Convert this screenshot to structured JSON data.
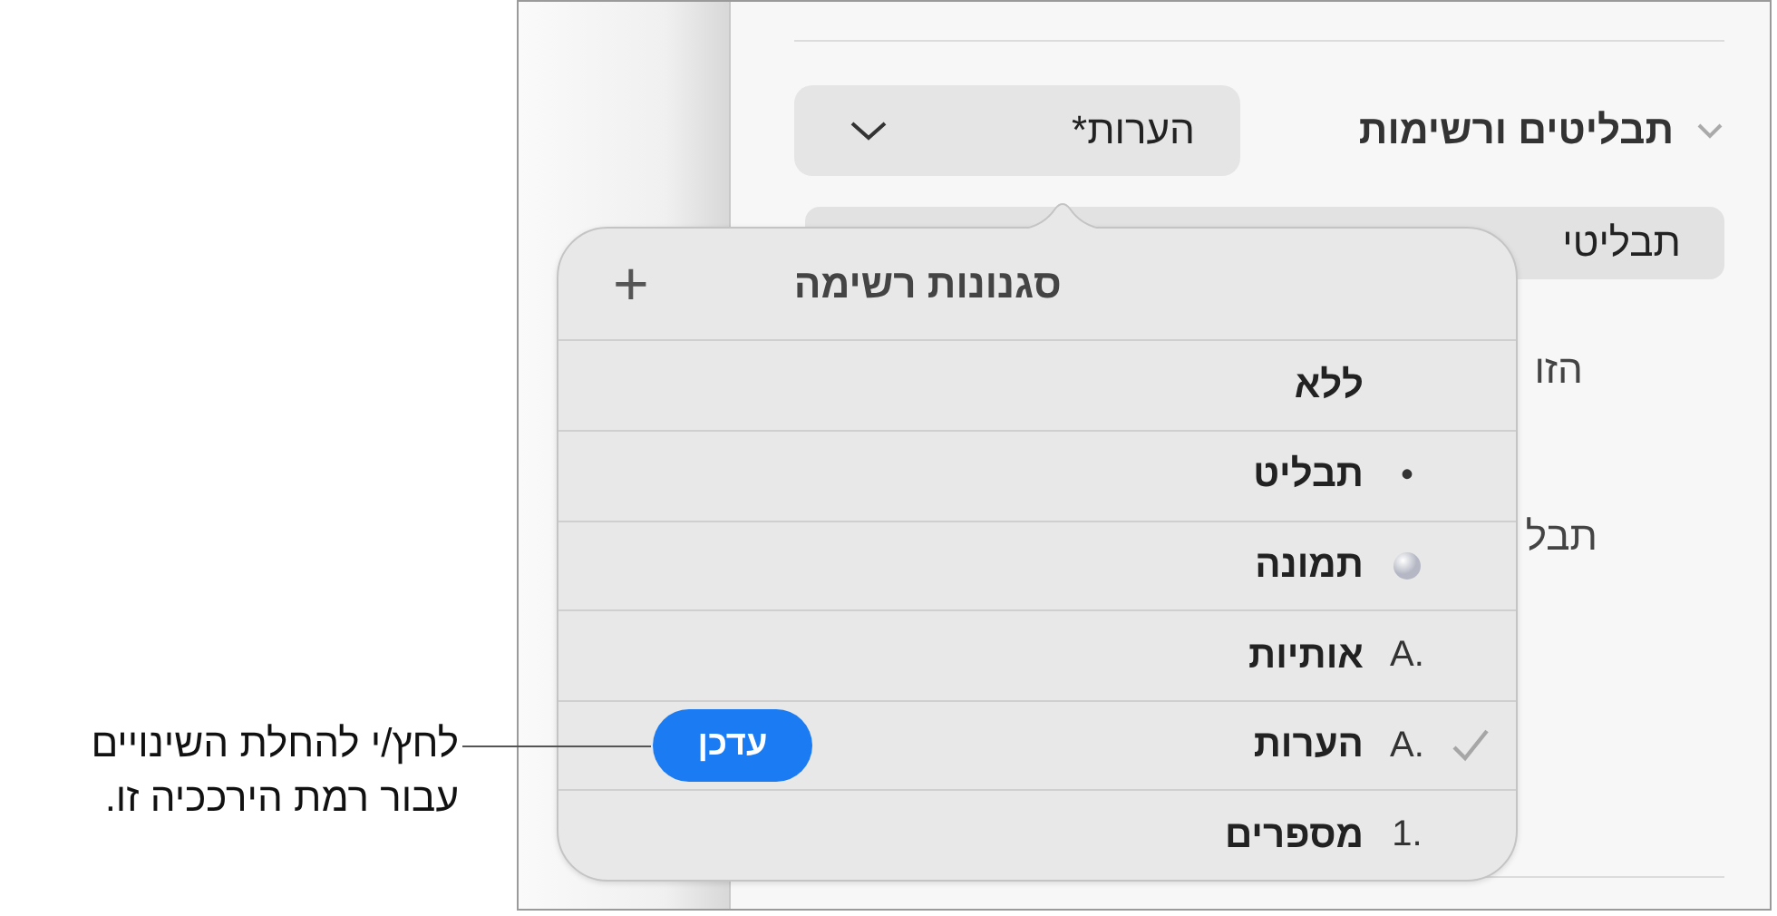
{
  "callout": {
    "text": "לחץ/י להחלת השינויים עבור רמת הירככיה זו."
  },
  "panel": {
    "section_title": "תבליטים ורשימות",
    "expanded": true,
    "style_popup": "הערות*",
    "partial_texts": [
      "תבליטי",
      "הזו",
      "תבל"
    ]
  },
  "popover": {
    "title": "סגנונות רשימה",
    "add": "+",
    "items": [
      {
        "label": "ללא",
        "kind": "none",
        "selected": false
      },
      {
        "label": "תבליט",
        "kind": "text",
        "marker": "•",
        "selected": false
      },
      {
        "label": "תמונה",
        "kind": "image",
        "selected": false
      },
      {
        "label": "אותיות",
        "kind": "text",
        "marker": "A.",
        "selected": false
      },
      {
        "label": "הערות",
        "kind": "text",
        "marker": "A.",
        "selected": true,
        "action": "עדכן"
      },
      {
        "label": "מספרים",
        "kind": "text",
        "marker": "1.",
        "selected": false
      }
    ]
  }
}
